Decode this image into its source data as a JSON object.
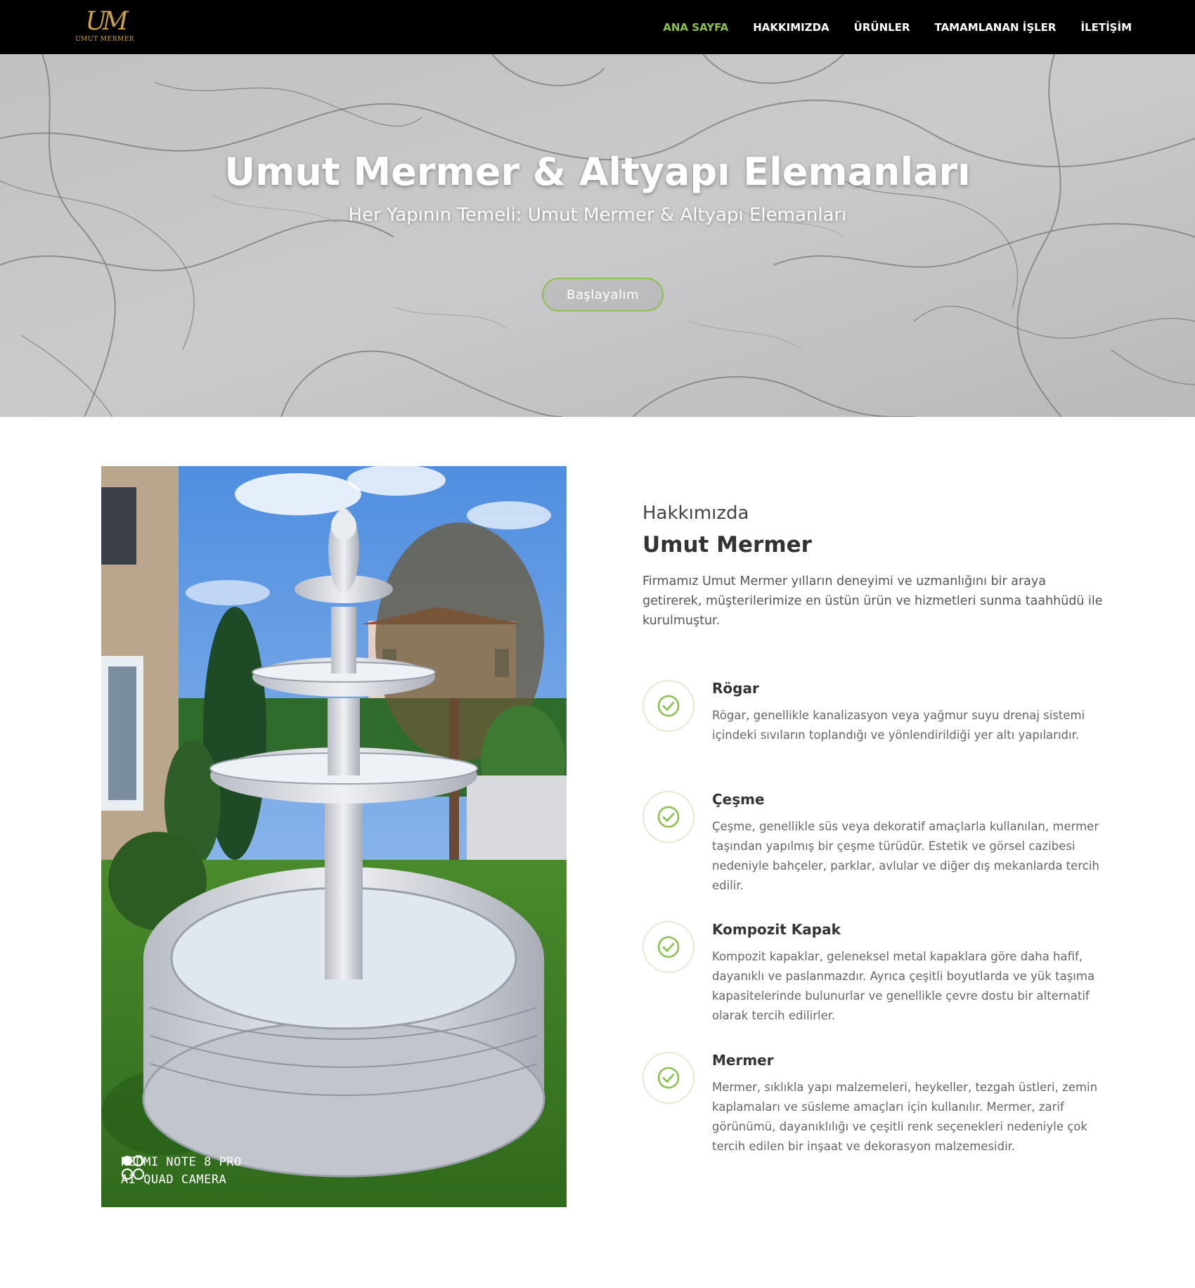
{
  "nav": {
    "logo_mark": "UM",
    "logo_text": "UMUT MERMER",
    "items": [
      {
        "label": "ANA SAYFA",
        "active": true
      },
      {
        "label": "HAKKIMIZDA",
        "active": false
      },
      {
        "label": "ÜRÜNLER",
        "active": false
      },
      {
        "label": "TAMAMLANAN İŞLER",
        "active": false
      },
      {
        "label": "İLETİŞİM",
        "active": false
      }
    ]
  },
  "hero": {
    "title": "Umut Mermer & Altyapı Elemanları",
    "subtitle": "Her Yapının Temeli: Umut Mermer & Altyapı Elemanları",
    "button_label": "Başlayalım"
  },
  "photo": {
    "camera_line1": "REDMI NOTE 8 PRO",
    "camera_line2": "AI QUAD CAMERA"
  },
  "about": {
    "kicker": "Hakkımızda",
    "title": "Umut Mermer",
    "description": "Firmamız Umut Mermer yılların deneyimi ve uzmanlığını bir araya getirerek, müşterilerimize en üstün ürün ve hizmetleri sunma taahhüdü ile kurulmuştur.",
    "features": [
      {
        "title": "Rögar",
        "text": "Rögar, genellikle kanalizasyon veya yağmur suyu drenaj sistemi içindeki sıvıların toplandığı ve yönlendirildiği yer altı yapılarıdır.",
        "icon": "check-circle-icon"
      },
      {
        "title": "Çeşme",
        "text": "Çeşme, genellikle süs veya dekoratif amaçlarla kullanılan, mermer taşından yapılmış bir çeşme türüdür. Estetik ve görsel cazibesi nedeniyle bahçeler, parklar, avlular ve diğer dış mekanlarda tercih edilir.",
        "icon": "check-circle-icon"
      },
      {
        "title": "Kompozit Kapak",
        "text": "Kompozit kapaklar, geleneksel metal kapaklara göre daha hafif, dayanıklı ve paslanmazdır. Ayrıca çeşitli boyutlarda ve yük taşıma kapasitelerinde bulunurlar ve genellikle çevre dostu bir alternatif olarak tercih edilirler.",
        "icon": "check-circle-icon"
      },
      {
        "title": "Mermer",
        "text": "Mermer, sıklıkla yapı malzemeleri, heykeller, tezgah üstleri, zemin kaplamaları ve süsleme amaçları için kullanılır. Mermer, zarif görünümü, dayanıklılığı ve çeşitli renk seçenekleri nedeniyle çok tercih edilen bir inşaat ve dekorasyon malzemesidir.",
        "icon": "check-circle-icon"
      }
    ]
  },
  "colors": {
    "accent": "#8cc152",
    "nav_bg": "#000000",
    "logo_gold": "#c9a24a"
  }
}
